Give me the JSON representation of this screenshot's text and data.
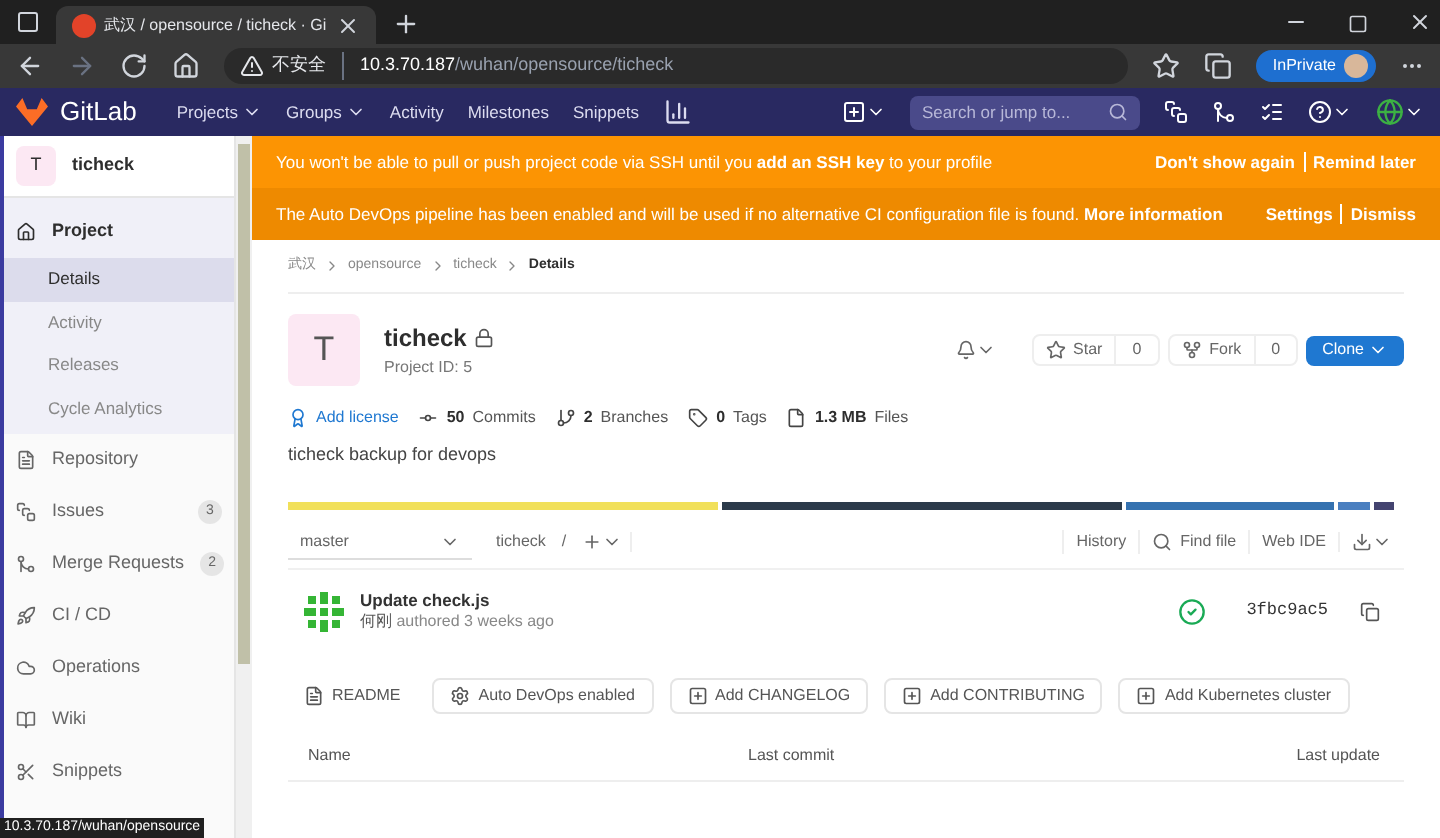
{
  "browser": {
    "tab_title": "武汉 / opensource / ticheck · Gi",
    "url_warning": "不安全",
    "url_host": "10.3.70.187",
    "url_path": "/wuhan/opensource/ticheck",
    "inprivate": "InPrivate"
  },
  "topnav": {
    "brand": "GitLab",
    "items": [
      {
        "label": "Projects",
        "dropdown": true
      },
      {
        "label": "Groups",
        "dropdown": true
      },
      {
        "label": "Activity",
        "dropdown": false
      },
      {
        "label": "Milestones",
        "dropdown": false
      },
      {
        "label": "Snippets",
        "dropdown": false
      }
    ],
    "search": {
      "placeholder": "Search or jump to..."
    }
  },
  "sidebar": {
    "project_letter": "T",
    "project_name": "ticheck",
    "items": [
      {
        "label": "Project",
        "kind": "project",
        "selected": true,
        "children": [
          {
            "label": "Details",
            "selected": true
          },
          {
            "label": "Activity",
            "selected": false
          },
          {
            "label": "Releases",
            "selected": false
          },
          {
            "label": "Cycle Analytics",
            "selected": false
          }
        ]
      },
      {
        "label": "Repository",
        "kind": "repository",
        "selected": false
      },
      {
        "label": "Issues",
        "kind": "issues",
        "selected": false,
        "count": "3"
      },
      {
        "label": "Merge Requests",
        "kind": "merge_requests",
        "selected": false,
        "count": "2"
      },
      {
        "label": "CI / CD",
        "kind": "cicd",
        "selected": false
      },
      {
        "label": "Operations",
        "kind": "operations",
        "selected": false
      },
      {
        "label": "Wiki",
        "kind": "wiki",
        "selected": false
      },
      {
        "label": "Snippets",
        "kind": "snippets",
        "selected": false
      }
    ]
  },
  "banners": [
    {
      "text": "You won't be able to pull or push project code via SSH until you **add an SSH key** to your profile",
      "actions": [
        "Don't show again",
        "Remind later"
      ]
    },
    {
      "text": "The Auto DevOps pipeline has been enabled and will be used if no alternative CI configuration file is found. **More information**",
      "actions": [
        "Settings",
        "Dismiss"
      ]
    }
  ],
  "breadcrumbs": [
    "武汉",
    "opensource",
    "ticheck",
    "Details"
  ],
  "project": {
    "letter": "T",
    "name": "ticheck",
    "id": "Project ID: 5",
    "star_label": "Star",
    "star_count": "0",
    "fork_label": "Fork",
    "fork_count": "0",
    "clone": "Clone",
    "stats": [
      {
        "kind": "license",
        "label": "Add license"
      },
      {
        "kind": "commits",
        "value": "50",
        "label": "Commits"
      },
      {
        "kind": "branches",
        "value": "2",
        "label": "Branches"
      },
      {
        "kind": "tags",
        "value": "0",
        "label": "Tags"
      },
      {
        "kind": "files",
        "value": "1.3 MB",
        "label": "Files"
      }
    ],
    "description": "ticheck backup for devops"
  },
  "repo_bar": {
    "branch": "master",
    "path": "ticheck",
    "separator": "/",
    "actions": [
      "History",
      "Find file",
      "Web IDE"
    ]
  },
  "last_commit": {
    "message": "Update check.js",
    "author": "何刚",
    "meta": "authored 3 weeks ago",
    "sha": "3fbc9ac5"
  },
  "shortcuts": [
    {
      "kind": "readme",
      "label": "README"
    },
    {
      "kind": "devops",
      "label": "Auto DevOps enabled"
    },
    {
      "kind": "add",
      "label": "Add CHANGELOG"
    },
    {
      "kind": "add",
      "label": "Add CONTRIBUTING"
    },
    {
      "kind": "add",
      "label": "Add Kubernetes cluster"
    }
  ],
  "table": {
    "columns": [
      "Name",
      "Last commit",
      "Last update"
    ]
  },
  "status_url": "10.3.70.187/wuhan/opensource"
}
